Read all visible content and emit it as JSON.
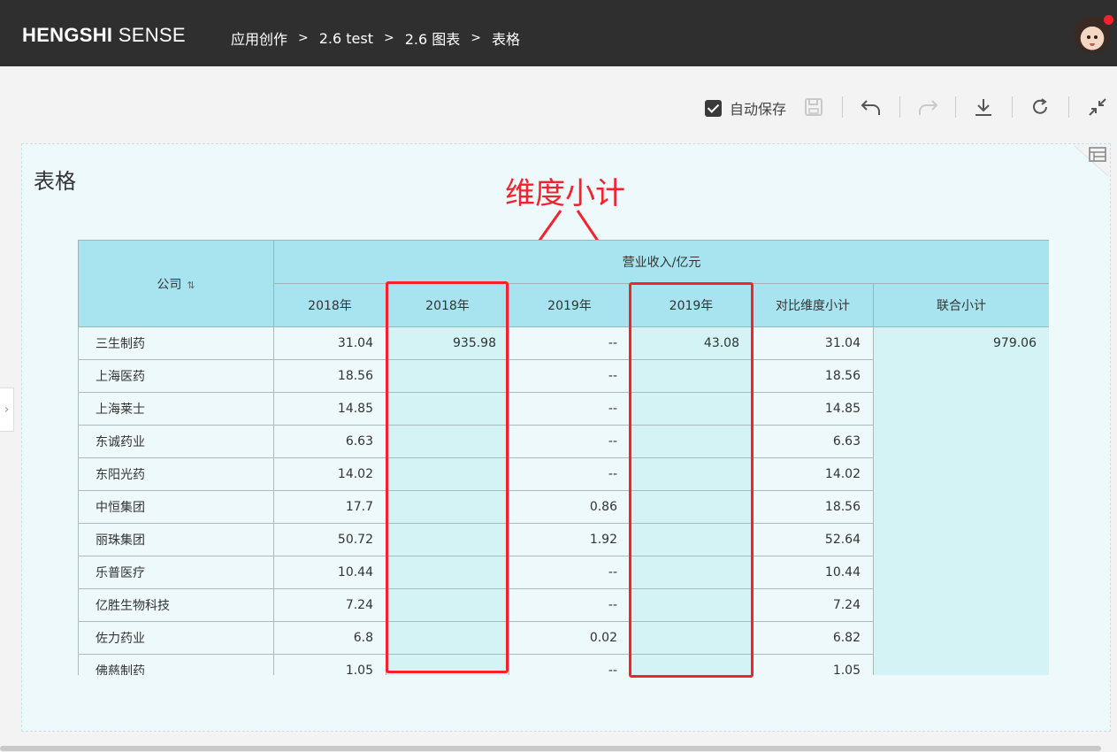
{
  "app": {
    "logo_bold": "HENGSHI",
    "logo_rest": " SENSE"
  },
  "breadcrumb": [
    "应用创作",
    "2.6 test",
    "2.6 图表",
    "表格"
  ],
  "breadcrumb_sep": ">",
  "toolbar": {
    "autosave_label": "自动保存",
    "autosave_checked": true
  },
  "panel": {
    "title": "表格"
  },
  "annotation": {
    "text": "维度小计",
    "color": "#f5222d"
  },
  "table": {
    "corner_header": "公司",
    "group_header": "营业收入/亿元",
    "columns": [
      "2018年",
      "2018年",
      "2019年",
      "2019年",
      "对比维度小计",
      "联合小计"
    ],
    "rows": [
      {
        "company": "三生制药",
        "c1": "31.04",
        "c2": "935.98",
        "c3": "--",
        "c4": "43.08",
        "c5": "31.04"
      },
      {
        "company": "上海医药",
        "c1": "18.56",
        "c2": "",
        "c3": "--",
        "c4": "",
        "c5": "18.56"
      },
      {
        "company": "上海莱士",
        "c1": "14.85",
        "c2": "",
        "c3": "--",
        "c4": "",
        "c5": "14.85"
      },
      {
        "company": "东诚药业",
        "c1": "6.63",
        "c2": "",
        "c3": "--",
        "c4": "",
        "c5": "6.63"
      },
      {
        "company": "东阳光药",
        "c1": "14.02",
        "c2": "",
        "c3": "--",
        "c4": "",
        "c5": "14.02"
      },
      {
        "company": "中恒集团",
        "c1": "17.7",
        "c2": "",
        "c3": "0.86",
        "c4": "",
        "c5": "18.56"
      },
      {
        "company": "丽珠集团",
        "c1": "50.72",
        "c2": "",
        "c3": "1.92",
        "c4": "",
        "c5": "52.64"
      },
      {
        "company": "乐普医疗",
        "c1": "10.44",
        "c2": "",
        "c3": "--",
        "c4": "",
        "c5": "10.44"
      },
      {
        "company": "亿胜生物科技",
        "c1": "7.24",
        "c2": "",
        "c3": "--",
        "c4": "",
        "c5": "7.24"
      },
      {
        "company": "佐力药业",
        "c1": "6.8",
        "c2": "",
        "c3": "0.02",
        "c4": "",
        "c5": "6.82"
      },
      {
        "company": "佛慈制药",
        "c1": "1.05",
        "c2": "",
        "c3": "--",
        "c4": "",
        "c5": "1.05"
      }
    ],
    "union_total": "979.06"
  },
  "colors": {
    "topbar": "#2f2f2f",
    "header_bg": "#a7e4ef",
    "subtotal_bg": "#d3f3f4",
    "panel_bg": "#eef9fb",
    "highlight": "#f5222d"
  }
}
